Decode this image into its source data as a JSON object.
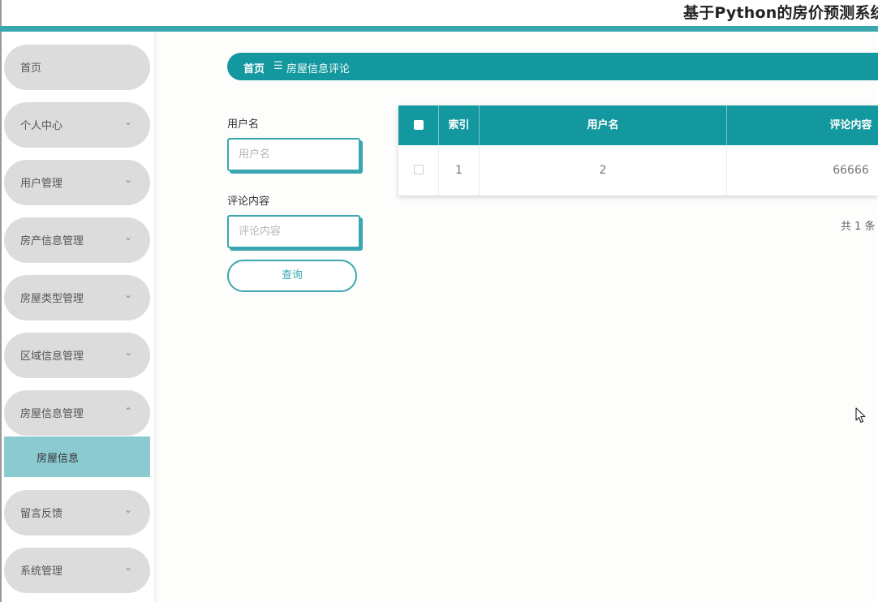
{
  "app": {
    "title": "基于Python的房价预测系统"
  },
  "sidebar": {
    "items": [
      {
        "label": "首页",
        "has_chevron": false
      },
      {
        "label": "个人中心",
        "has_chevron": true
      },
      {
        "label": "用户管理",
        "has_chevron": true
      },
      {
        "label": "房产信息管理",
        "has_chevron": true
      },
      {
        "label": "房屋类型管理",
        "has_chevron": true
      },
      {
        "label": "区域信息管理",
        "has_chevron": true
      },
      {
        "label": "房屋信息管理",
        "has_chevron": true,
        "expanded": true
      },
      {
        "label": "留言反馈",
        "has_chevron": true
      },
      {
        "label": "系统管理",
        "has_chevron": true
      }
    ],
    "submenu": {
      "label": "房屋信息",
      "active": true
    },
    "chevron_down": "⌄",
    "chevron_up": "⌃"
  },
  "breadcrumb": {
    "home": "首页",
    "separator": "☰",
    "current": "房屋信息评论"
  },
  "search": {
    "username_label": "用户名",
    "username_placeholder": "用户名",
    "username_value": "",
    "comment_label": "评论内容",
    "comment_placeholder": "评论内容",
    "comment_value": "",
    "query_button": "查询"
  },
  "table": {
    "headers": {
      "index": "索引",
      "username": "用户名",
      "comment": "评论内容"
    },
    "rows": [
      {
        "index": "1",
        "username": "2",
        "comment": "66666"
      }
    ],
    "total": "共 1 条"
  },
  "colors": {
    "accent": "#14989f",
    "accent_light": "#3aa7b0",
    "submenu_active": "#8ccad2",
    "menu_bg": "#dcdcdc"
  },
  "icons": {
    "cursor": "mouse-pointer-icon",
    "chevron": "chevron-down-icon"
  }
}
